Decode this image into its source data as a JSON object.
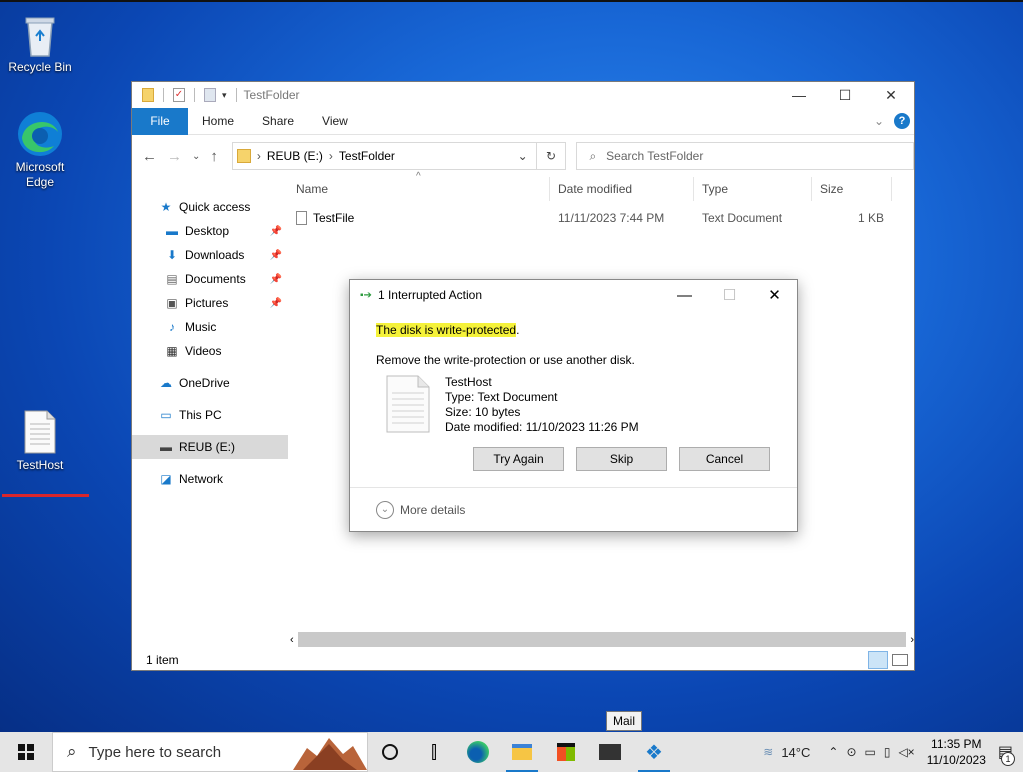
{
  "desktop": {
    "icons": [
      {
        "label": "Recycle Bin"
      },
      {
        "label": "Microsoft Edge"
      },
      {
        "label": "TestHost"
      }
    ]
  },
  "explorer": {
    "title": "TestFolder",
    "ribbon_tabs": [
      "File",
      "Home",
      "Share",
      "View"
    ],
    "address": {
      "drive": "REUB (E:)",
      "folder": "TestFolder"
    },
    "search_placeholder": "Search TestFolder",
    "nav": {
      "quick_access": "Quick access",
      "items": [
        "Desktop",
        "Downloads",
        "Documents",
        "Pictures",
        "Music",
        "Videos"
      ],
      "onedrive": "OneDrive",
      "this_pc": "This PC",
      "drive": "REUB (E:)",
      "network": "Network"
    },
    "columns": [
      "Name",
      "Date modified",
      "Type",
      "Size"
    ],
    "files": [
      {
        "name": "TestFile",
        "date": "11/11/2023 7:44 PM",
        "type": "Text Document",
        "size": "1 KB"
      }
    ],
    "status": "1 item"
  },
  "dialog": {
    "title": "1 Interrupted Action",
    "heading": "The disk is write-protected",
    "heading_suffix": ".",
    "message": "Remove the write-protection or use another disk.",
    "file": {
      "name": "TestHost",
      "type": "Type: Text Document",
      "size": "Size: 10 bytes",
      "date": "Date modified: 11/10/2023 11:26 PM"
    },
    "buttons": {
      "try_again": "Try Again",
      "skip": "Skip",
      "cancel": "Cancel"
    },
    "more_details": "More details"
  },
  "taskbar": {
    "search_placeholder": "Type here to search",
    "tooltip": "Mail",
    "weather": "14°C",
    "time": "11:35 PM",
    "date": "11/10/2023",
    "notification_count": "1"
  },
  "colors": {
    "accent": "#1979ca",
    "highlight": "#f5f23a",
    "red_line": "#d9262c"
  }
}
